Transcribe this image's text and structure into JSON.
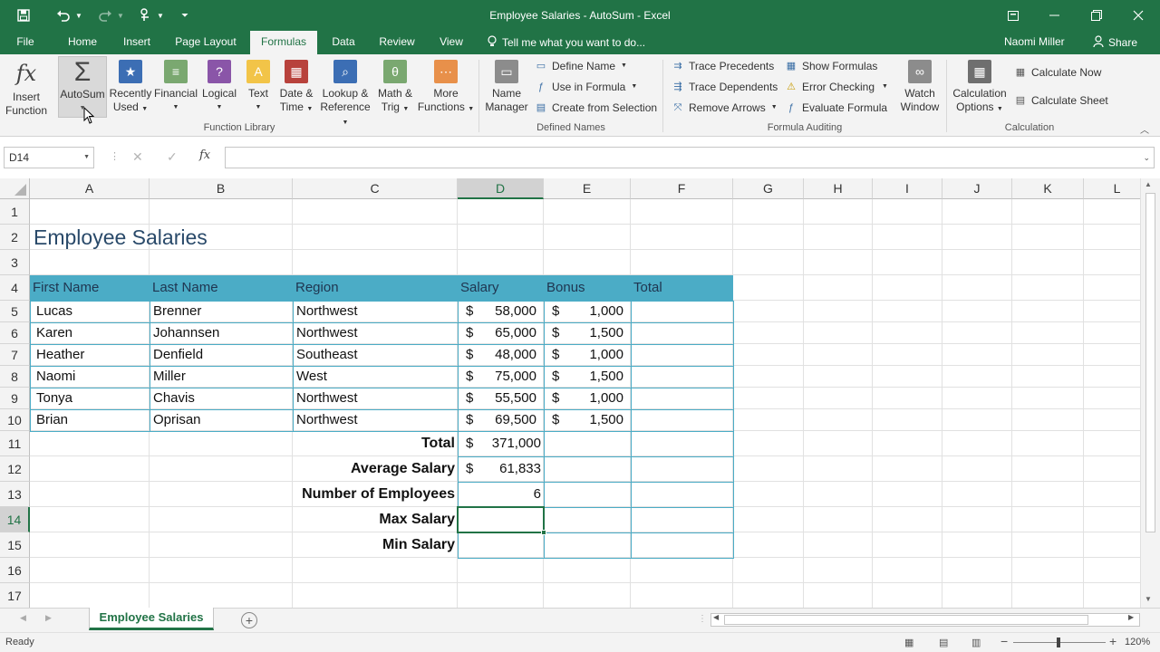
{
  "window": {
    "title": "Employee Salaries - AutoSum - Excel",
    "user": "Naomi Miller",
    "share_label": "Share"
  },
  "menu_tabs": [
    {
      "label": "File"
    },
    {
      "label": "Home"
    },
    {
      "label": "Insert"
    },
    {
      "label": "Page Layout"
    },
    {
      "label": "Formulas",
      "active": true
    },
    {
      "label": "Data"
    },
    {
      "label": "Review"
    },
    {
      "label": "View"
    }
  ],
  "tell_me": "Tell me what you want to do...",
  "ribbon": {
    "function_library": {
      "group_label": "Function Library",
      "insert_function": {
        "line1": "Insert",
        "line2": "Function"
      },
      "autosum": {
        "line1": "AutoSum"
      },
      "recently_used": {
        "line1": "Recently",
        "line2": "Used"
      },
      "financial": {
        "line1": "Financial"
      },
      "logical": {
        "line1": "Logical"
      },
      "text": {
        "line1": "Text"
      },
      "date_time": {
        "line1": "Date &",
        "line2": "Time"
      },
      "lookup_reference": {
        "line1": "Lookup &",
        "line2": "Reference"
      },
      "math_trig": {
        "line1": "Math &",
        "line2": "Trig"
      },
      "more_functions": {
        "line1": "More",
        "line2": "Functions"
      }
    },
    "defined_names": {
      "group_label": "Defined Names",
      "name_manager": {
        "line1": "Name",
        "line2": "Manager"
      },
      "define_name": "Define Name",
      "use_in_formula": "Use in Formula",
      "create_from_selection": "Create from Selection"
    },
    "formula_auditing": {
      "group_label": "Formula Auditing",
      "trace_precedents": "Trace Precedents",
      "trace_dependents": "Trace Dependents",
      "remove_arrows": "Remove Arrows",
      "show_formulas": "Show Formulas",
      "error_checking": "Error Checking",
      "evaluate_formula": "Evaluate Formula",
      "watch_window": {
        "line1": "Watch",
        "line2": "Window"
      }
    },
    "calculation": {
      "group_label": "Calculation",
      "calculation_options": {
        "line1": "Calculation",
        "line2": "Options"
      },
      "calculate_now": "Calculate Now",
      "calculate_sheet": "Calculate Sheet"
    }
  },
  "formula_bar": {
    "name_box": "D14",
    "fx_label": "fx",
    "content": ""
  },
  "columns": [
    "A",
    "B",
    "C",
    "D",
    "E",
    "F",
    "G",
    "H",
    "I",
    "J",
    "K",
    "L"
  ],
  "rows": [
    "1",
    "2",
    "3",
    "4",
    "5",
    "6",
    "7",
    "8",
    "9",
    "10",
    "11",
    "12",
    "13",
    "14",
    "15",
    "16",
    "17"
  ],
  "sheet": {
    "title": "Employee Salaries",
    "headers": [
      "First Name",
      "Last Name",
      "Region",
      "Salary",
      "Bonus",
      "Total"
    ],
    "currency_symbol": "$",
    "data_rows": [
      {
        "first": "Lucas",
        "last": "Brenner",
        "region": "Northwest",
        "salary": "58,000",
        "bonus": "1,000"
      },
      {
        "first": "Karen",
        "last": "Johannsen",
        "region": "Northwest",
        "salary": "65,000",
        "bonus": "1,500"
      },
      {
        "first": "Heather",
        "last": "Denfield",
        "region": "Southeast",
        "salary": "48,000",
        "bonus": "1,000"
      },
      {
        "first": "Naomi",
        "last": "Miller",
        "region": "West",
        "salary": "75,000",
        "bonus": "1,500"
      },
      {
        "first": "Tonya",
        "last": "Chavis",
        "region": "Northwest",
        "salary": "55,500",
        "bonus": "1,000"
      },
      {
        "first": "Brian",
        "last": "Oprisan",
        "region": "Northwest",
        "salary": "69,500",
        "bonus": "1,500"
      }
    ],
    "summary": [
      {
        "label": "Total",
        "currency": "$",
        "value": "371,000"
      },
      {
        "label": "Average Salary",
        "currency": "$",
        "value": "61,833"
      },
      {
        "label": "Number of Employees",
        "currency": "",
        "value": "6"
      },
      {
        "label": "Max Salary",
        "currency": "",
        "value": ""
      },
      {
        "label": "Min Salary",
        "currency": "",
        "value": ""
      }
    ]
  },
  "sheet_tabs": [
    {
      "label": "Employee Salaries",
      "active": true
    }
  ],
  "status": {
    "mode": "Ready",
    "zoom": "120%"
  },
  "colors": {
    "excel_green": "#217346",
    "table_header_bg": "#4bacc6",
    "table_border": "#4bacc6"
  }
}
